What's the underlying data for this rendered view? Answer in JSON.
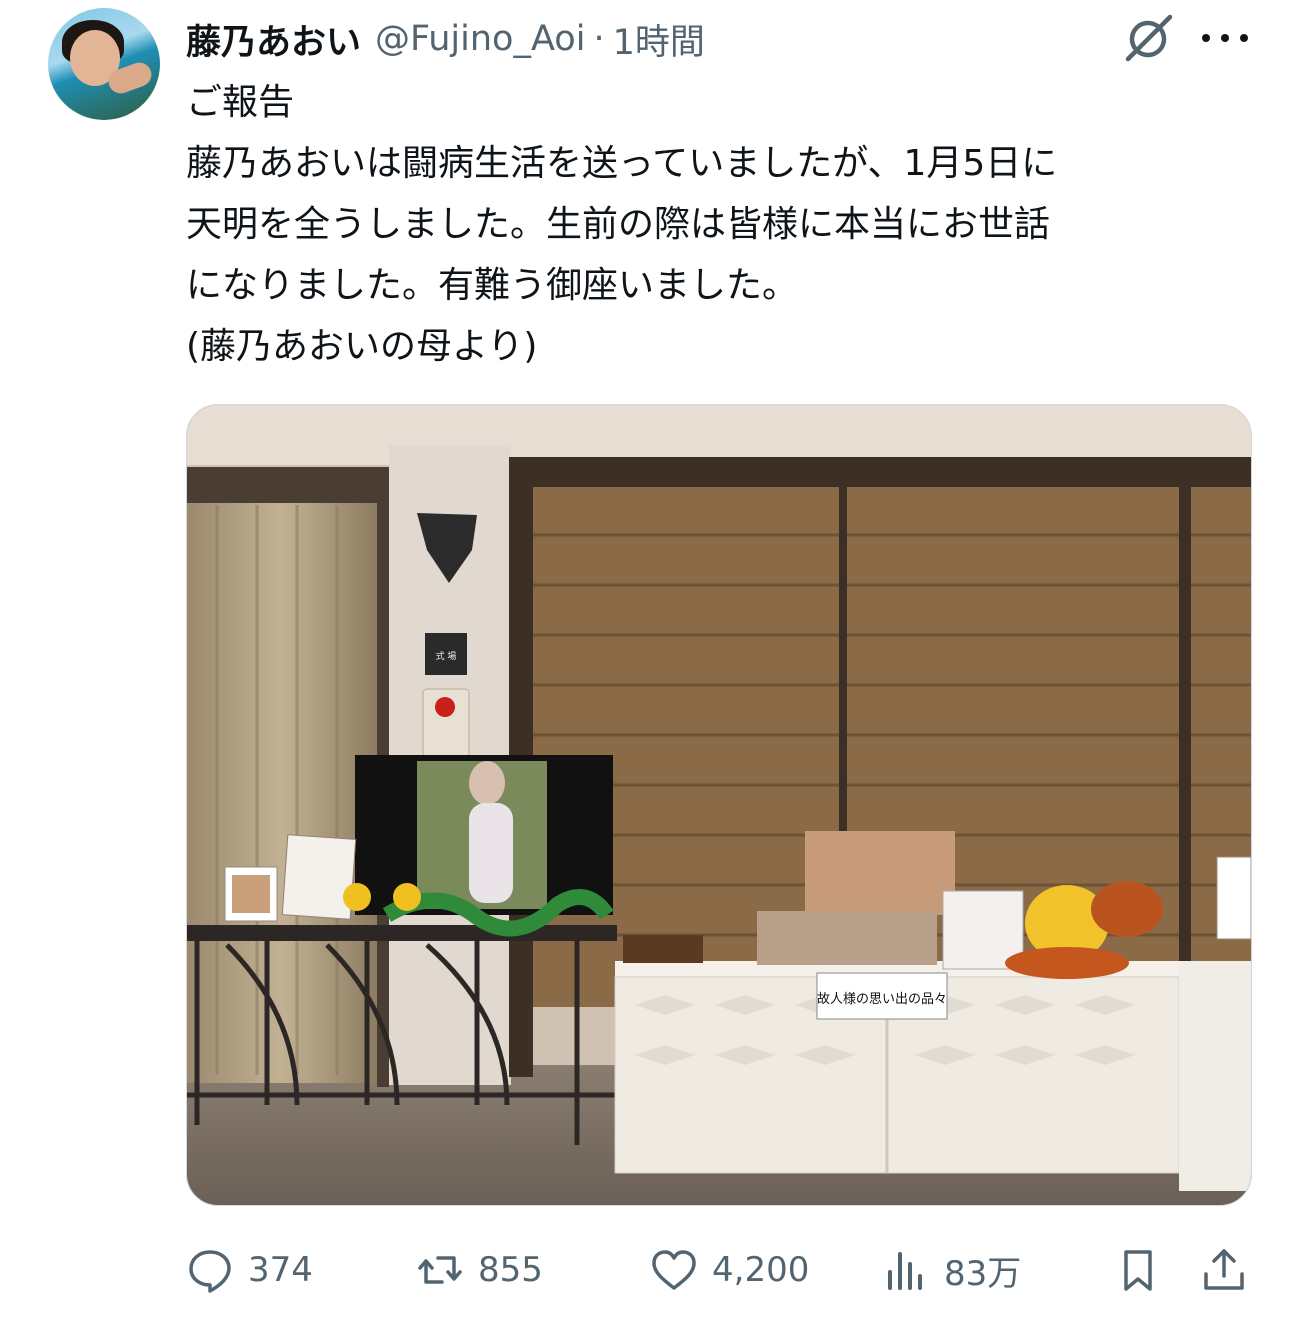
{
  "tweet": {
    "display_name": "藤乃あおい",
    "handle": "@Fujino_Aoi",
    "separator": "·",
    "time": "1時間",
    "lines": [
      "ご報告",
      "藤乃あおいは闘病生活を送っていましたが、1月5日に",
      "天明を全うしました。生前の際は皆様に本当にお世話",
      "になりました。有難う御座いました。",
      "(藤乃あおいの母より)"
    ]
  },
  "media": {
    "wall_sign": "式 場",
    "table_sign": "故人様の思い出の品々"
  },
  "actions": {
    "replies": "374",
    "reposts": "855",
    "likes": "4,200",
    "views": "83万"
  },
  "icons": {
    "grok": "grok-icon",
    "more": "more-icon",
    "reply": "reply-icon",
    "repost": "repost-icon",
    "like": "heart-icon",
    "views": "views-icon",
    "bookmark": "bookmark-icon",
    "share": "share-icon"
  },
  "colors": {
    "text": "#0f1419",
    "secondary": "#536471",
    "border": "#cfd9de"
  }
}
